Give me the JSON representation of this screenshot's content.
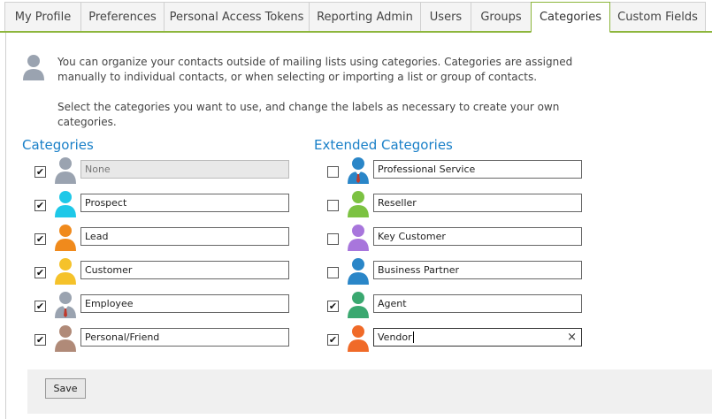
{
  "tabs": [
    {
      "label": "My Profile",
      "active": false
    },
    {
      "label": "Preferences",
      "active": false
    },
    {
      "label": "Personal Access Tokens",
      "active": false
    },
    {
      "label": "Reporting Admin",
      "active": false
    },
    {
      "label": "Users",
      "active": false
    },
    {
      "label": "Groups",
      "active": false
    },
    {
      "label": "Categories",
      "active": true
    },
    {
      "label": "Custom Fields",
      "active": false
    }
  ],
  "intro": {
    "line1": "You can organize your contacts outside of mailing lists using categories. Categories are assigned manually to individual contacts, or when selecting or importing a list or group of contacts.",
    "line2": "Select the categories you want to use, and change the labels as necessary to create your own categories."
  },
  "categories": {
    "heading": "Categories",
    "items": [
      {
        "label": "None",
        "checked": true,
        "disabled": true,
        "color": "#9aa3b0",
        "icon": "person-icon"
      },
      {
        "label": "Prospect",
        "checked": true,
        "color": "#1ec8e8",
        "icon": "person-icon"
      },
      {
        "label": "Lead",
        "checked": true,
        "color": "#f08a1c",
        "icon": "person-icon"
      },
      {
        "label": "Customer",
        "checked": true,
        "color": "#f5c22a",
        "icon": "person-icon"
      },
      {
        "label": "Employee",
        "checked": true,
        "color": "#9aa3b0",
        "icon": "person-tie-icon"
      },
      {
        "label": "Personal/Friend",
        "checked": true,
        "color": "#b08a78",
        "icon": "person-icon"
      }
    ]
  },
  "extended": {
    "heading": "Extended Categories",
    "items": [
      {
        "label": "Professional Service",
        "checked": false,
        "color": "#2a86c8",
        "icon": "person-tie-icon"
      },
      {
        "label": "Reseller",
        "checked": false,
        "color": "#7cc242",
        "icon": "person-icon"
      },
      {
        "label": "Key Customer",
        "checked": false,
        "color": "#a876dc",
        "icon": "person-icon"
      },
      {
        "label": "Business Partner",
        "checked": false,
        "color": "#2a86c8",
        "icon": "person-icon"
      },
      {
        "label": "Agent",
        "checked": true,
        "color": "#3aa870",
        "icon": "person-icon"
      },
      {
        "label": "Vendor",
        "checked": true,
        "color": "#f06a28",
        "icon": "person-icon",
        "focused": true
      }
    ]
  },
  "footer": {
    "save_label": "Save"
  },
  "glyphs": {
    "check": "✔",
    "clear": "×"
  }
}
